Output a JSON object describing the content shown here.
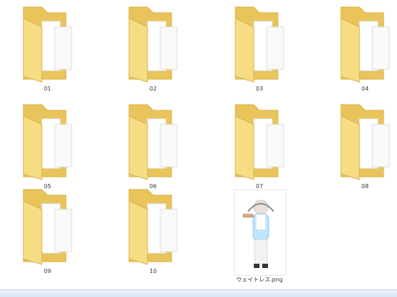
{
  "items": [
    {
      "label": "01",
      "type": "folder",
      "icon": "folder-icon"
    },
    {
      "label": "02",
      "type": "folder",
      "icon": "folder-icon"
    },
    {
      "label": "03",
      "type": "folder",
      "icon": "folder-icon"
    },
    {
      "label": "04",
      "type": "folder",
      "icon": "folder-icon"
    },
    {
      "label": "05",
      "type": "folder",
      "icon": "folder-icon"
    },
    {
      "label": "06",
      "type": "folder",
      "icon": "folder-icon"
    },
    {
      "label": "07",
      "type": "folder",
      "icon": "folder-icon"
    },
    {
      "label": "08",
      "type": "folder",
      "icon": "folder-icon"
    },
    {
      "label": "09",
      "type": "folder",
      "icon": "folder-icon"
    },
    {
      "label": "10",
      "type": "folder",
      "icon": "folder-icon"
    },
    {
      "label": "ウェイトレス.png",
      "type": "image",
      "icon": "image-thumbnail-icon"
    }
  ],
  "colors": {
    "folder_back": "#e9c45a",
    "folder_front": "#f6dd84",
    "folder_edge": "#d9b24a"
  }
}
